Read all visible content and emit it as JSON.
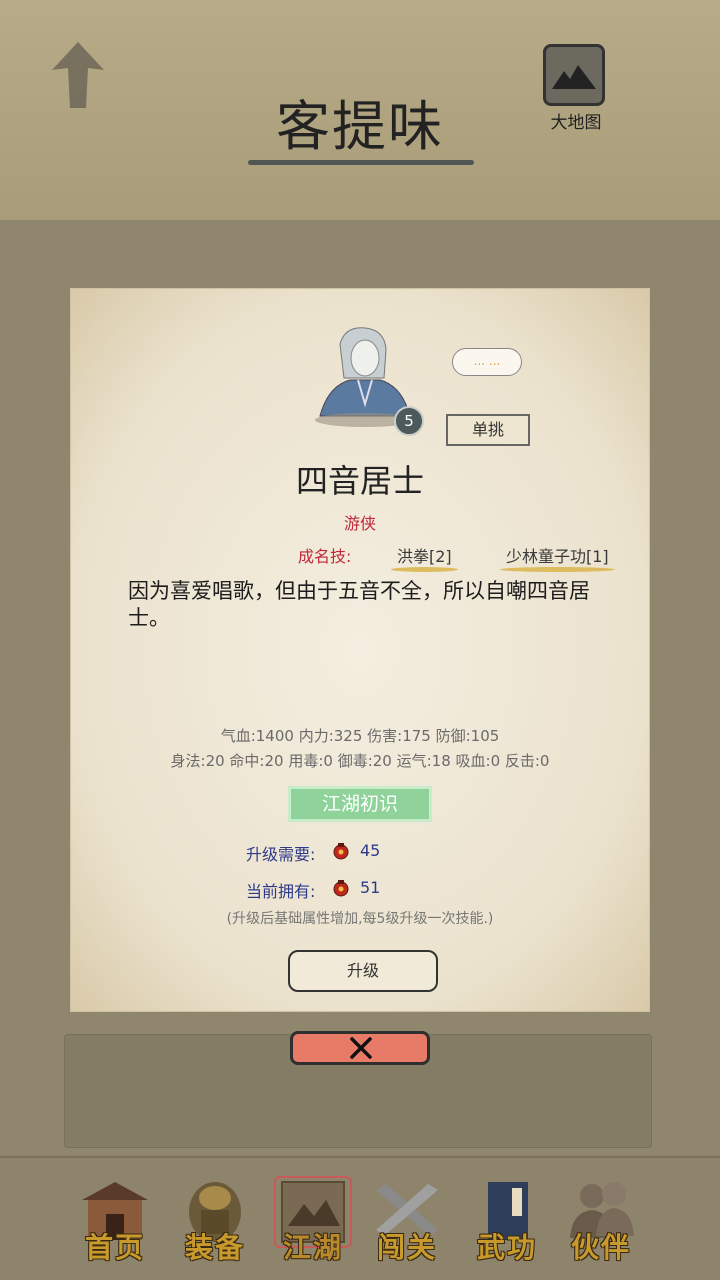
{
  "header": {
    "title": "客提味",
    "map_label": "大地图"
  },
  "character": {
    "name": "四音居士",
    "class": "游侠",
    "level": "5",
    "speech": "... ...",
    "duel_label": "单挑",
    "skills_label": "成名技:",
    "skills": [
      "洪拳[2]",
      "少林童子功[1]"
    ],
    "description": "因为喜爱唱歌，但由于五音不全，所以自嘲四音居士。",
    "stats_line1": "气血:1400  内力:325  伤害:175  防御:105",
    "stats_line2": "身法:20  命中:20  用毒:0  御毒:20  运气:18  吸血:0  反击:0",
    "rank": "江湖初识",
    "upgrade_need_label": "升级需要:",
    "upgrade_need_value": "45",
    "current_have_label": "当前拥有:",
    "current_have_value": "51",
    "note": "(升级后基础属性增加,每5级升级一次技能.)",
    "upgrade_button": "升级"
  },
  "nav": {
    "items": [
      {
        "label": "首页",
        "icon": "house-icon"
      },
      {
        "label": "装备",
        "icon": "armor-icon"
      },
      {
        "label": "江湖",
        "icon": "scroll-map-icon",
        "active": true
      },
      {
        "label": "闯关",
        "icon": "crossed-swords-icon"
      },
      {
        "label": "武功",
        "icon": "book-icon"
      },
      {
        "label": "伙伴",
        "icon": "people-icon"
      }
    ]
  },
  "colors": {
    "accent_red": "#c0283a",
    "rank_green": "#8fd39b",
    "close_red": "#e87a68",
    "nav_gold": "#c89a2c"
  }
}
